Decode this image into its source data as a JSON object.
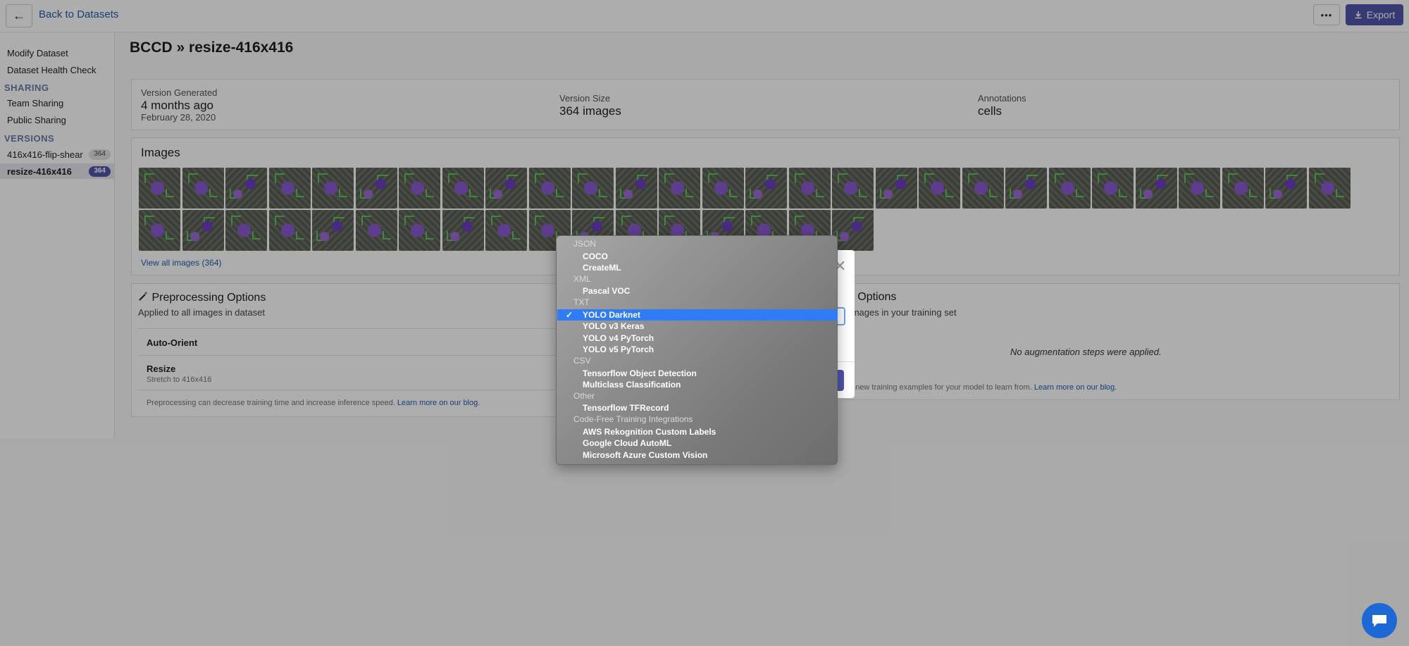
{
  "topbar": {
    "back_label": "Back to Datasets",
    "export_label": "Export",
    "more_label": "•••"
  },
  "sidebar": {
    "items": [
      "Modify Dataset",
      "Dataset Health Check"
    ],
    "sharing_heading": "SHARING",
    "sharing_items": [
      "Team Sharing",
      "Public Sharing"
    ],
    "versions_heading": "VERSIONS",
    "versions": [
      {
        "name": "416x416-flip-shear",
        "count": "364"
      },
      {
        "name": "resize-416x416",
        "count": "364"
      }
    ]
  },
  "title": {
    "dataset": "BCCD",
    "version": "resize-416x416"
  },
  "stats": {
    "generated_label": "Version Generated",
    "generated_value": "4 months ago",
    "generated_date": "February 28, 2020",
    "size_label": "Version Size",
    "size_value": "364 images",
    "annotations_label": "Annotations",
    "annotations_value": "cells"
  },
  "images": {
    "title": "Images",
    "view_all": "View all images (364)"
  },
  "preprocessing": {
    "title": "Preprocessing Options",
    "subtitle": "Applied to all images in dataset",
    "steps": [
      {
        "name": "Auto-Orient",
        "detail": ""
      },
      {
        "name": "Resize",
        "detail": "Stretch to 416x416"
      }
    ],
    "footer": "Preprocessing can decrease training time and increase inference speed.",
    "footer_link": "Learn more on our blog."
  },
  "augmentation": {
    "title": "on Options",
    "subtitle": "o images in your training set",
    "empty": "No augmentation steps were applied.",
    "footer": "e new training examples for your model to learn from.",
    "footer_link": "Learn more on our blog."
  },
  "dropdown": {
    "groups": [
      {
        "label": "JSON",
        "items": [
          "COCO",
          "CreateML"
        ]
      },
      {
        "label": "XML",
        "items": [
          "Pascal VOC"
        ]
      },
      {
        "label": "TXT",
        "items": [
          "YOLO Darknet",
          "YOLO v3 Keras",
          "YOLO v4 PyTorch",
          "YOLO v5 PyTorch"
        ]
      },
      {
        "label": "CSV",
        "items": [
          "Tensorflow Object Detection",
          "Multiclass Classification"
        ]
      },
      {
        "label": "Other",
        "items": [
          "Tensorflow TFRecord"
        ]
      },
      {
        "label": "Code-Free Training Integrations",
        "items": [
          "AWS Rekognition Custom Labels",
          "Google Cloud AutoML",
          "Microsoft Azure Custom Vision"
        ]
      }
    ],
    "selected": "YOLO Darknet",
    "check": "✓"
  },
  "modal": {
    "close_glyph": "✕"
  }
}
